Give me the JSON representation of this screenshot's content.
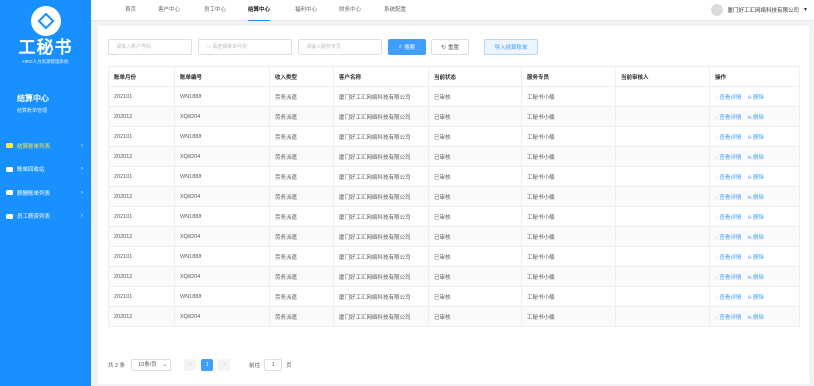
{
  "brand": {
    "title": "工秘书",
    "subtitle": "HRO人力资源管理系统"
  },
  "section": {
    "title": "结算中心",
    "subtitle": "结算账单管理"
  },
  "sidebar": {
    "items": [
      {
        "label": "结算账单列表",
        "icon": "bill-icon"
      },
      {
        "label": "账单回收站",
        "icon": "recycle-icon"
      },
      {
        "label": "薪酬账单列表",
        "icon": "salary-icon"
      },
      {
        "label": "员工薪资列表",
        "icon": "staff-icon"
      }
    ]
  },
  "nav": {
    "items": [
      "首页",
      "客户中心",
      "员工中心",
      "结算中心",
      "福利中心",
      "财务中心",
      "系统配置"
    ],
    "active_index": 3
  },
  "user": {
    "company": "厦门好工汇网络科技有限公司"
  },
  "filters": {
    "account_no_placeholder": "请输入账户号码",
    "month_placeholder": "请选择账单月份",
    "service_placeholder": "请输入服务专员"
  },
  "buttons": {
    "search": "搜索",
    "reset": "重置",
    "import": "导入结算账单"
  },
  "table": {
    "headers": [
      "账单月份",
      "账单编号",
      "收入类型",
      "客户名称",
      "当前状态",
      "服务专员",
      "当前审核人",
      "操作"
    ],
    "actions": {
      "view": "查看详情",
      "delete": "删除"
    },
    "rows": [
      [
        "202101",
        "WN1888",
        "劳务派遣",
        "厦门好工汇网络科技有限公司",
        "已审核",
        "工秘书小楠",
        ""
      ],
      [
        "202012",
        "XQ8204",
        "劳务派遣",
        "厦门好工汇网络科技有限公司",
        "已审核",
        "工秘书小楠",
        ""
      ],
      [
        "202101",
        "WN1888",
        "劳务派遣",
        "厦门好工汇网络科技有限公司",
        "已审核",
        "工秘书小楠",
        ""
      ],
      [
        "202012",
        "XQ8204",
        "劳务派遣",
        "厦门好工汇网络科技有限公司",
        "已审核",
        "工秘书小楠",
        ""
      ],
      [
        "202101",
        "WN1888",
        "劳务派遣",
        "厦门好工汇网络科技有限公司",
        "已审核",
        "工秘书小楠",
        ""
      ],
      [
        "202012",
        "XQ8204",
        "劳务派遣",
        "厦门好工汇网络科技有限公司",
        "已审核",
        "工秘书小楠",
        ""
      ],
      [
        "202101",
        "WN1888",
        "劳务派遣",
        "厦门好工汇网络科技有限公司",
        "已审核",
        "工秘书小楠",
        ""
      ],
      [
        "202012",
        "XQ8204",
        "劳务派遣",
        "厦门好工汇网络科技有限公司",
        "已审核",
        "工秘书小楠",
        ""
      ],
      [
        "202101",
        "WN1888",
        "劳务派遣",
        "厦门好工汇网络科技有限公司",
        "已审核",
        "工秘书小楠",
        ""
      ],
      [
        "202012",
        "XQ8204",
        "劳务派遣",
        "厦门好工汇网络科技有限公司",
        "已审核",
        "工秘书小楠",
        ""
      ],
      [
        "202101",
        "WN1888",
        "劳务派遣",
        "厦门好工汇网络科技有限公司",
        "已审核",
        "工秘书小楠",
        ""
      ],
      [
        "202012",
        "XQ8204",
        "劳务派遣",
        "厦门好工汇网络科技有限公司",
        "已审核",
        "工秘书小楠",
        ""
      ]
    ]
  },
  "pager": {
    "total": "共 2 条",
    "page_size": "10条/页",
    "prev": "‹",
    "page": "1",
    "next": "›",
    "goto": "前往",
    "goto_value": "1",
    "page_unit": "页"
  },
  "colors": {
    "primary": "#1890ff",
    "accent": "#409eff",
    "active_menu": "#ffeb3b"
  }
}
